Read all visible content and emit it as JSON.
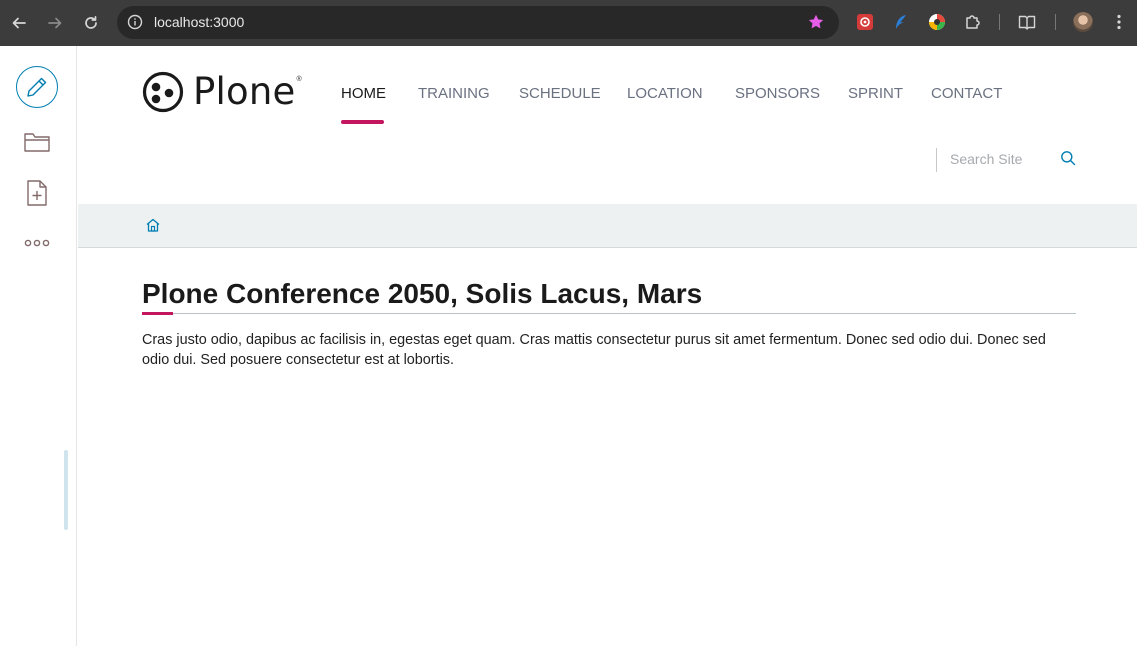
{
  "browser": {
    "url": "localhost:3000"
  },
  "site": {
    "logo_text": "Plone",
    "logo_mark": "®",
    "nav": [
      {
        "label": "HOME"
      },
      {
        "label": "TRAINING"
      },
      {
        "label": "SCHEDULE"
      },
      {
        "label": "LOCATION"
      },
      {
        "label": "SPONSORS"
      },
      {
        "label": "SPRINT"
      },
      {
        "label": "CONTACT"
      }
    ],
    "search": {
      "placeholder": "Search Site"
    }
  },
  "content": {
    "title": "Plone Conference 2050, Solis Lacus, Mars",
    "description": "Cras justo odio, dapibus ac facilisis in, egestas eget quam. Cras mattis consectetur purus sit amet fermentum. Donec sed odio dui. Donec sed odio dui. Sed posuere consectetur est at lobortis."
  },
  "colors": {
    "accent": "#c3165e",
    "link": "#007eb1",
    "breadcrumb_bg": "#edf1f2",
    "chrome_bg": "#3c3c3c"
  },
  "icons": {
    "toolbar": [
      "pencil-icon",
      "folder-icon",
      "add-document-icon",
      "more-icon"
    ],
    "breadcrumb": "home-icon",
    "search": "search-icon"
  }
}
